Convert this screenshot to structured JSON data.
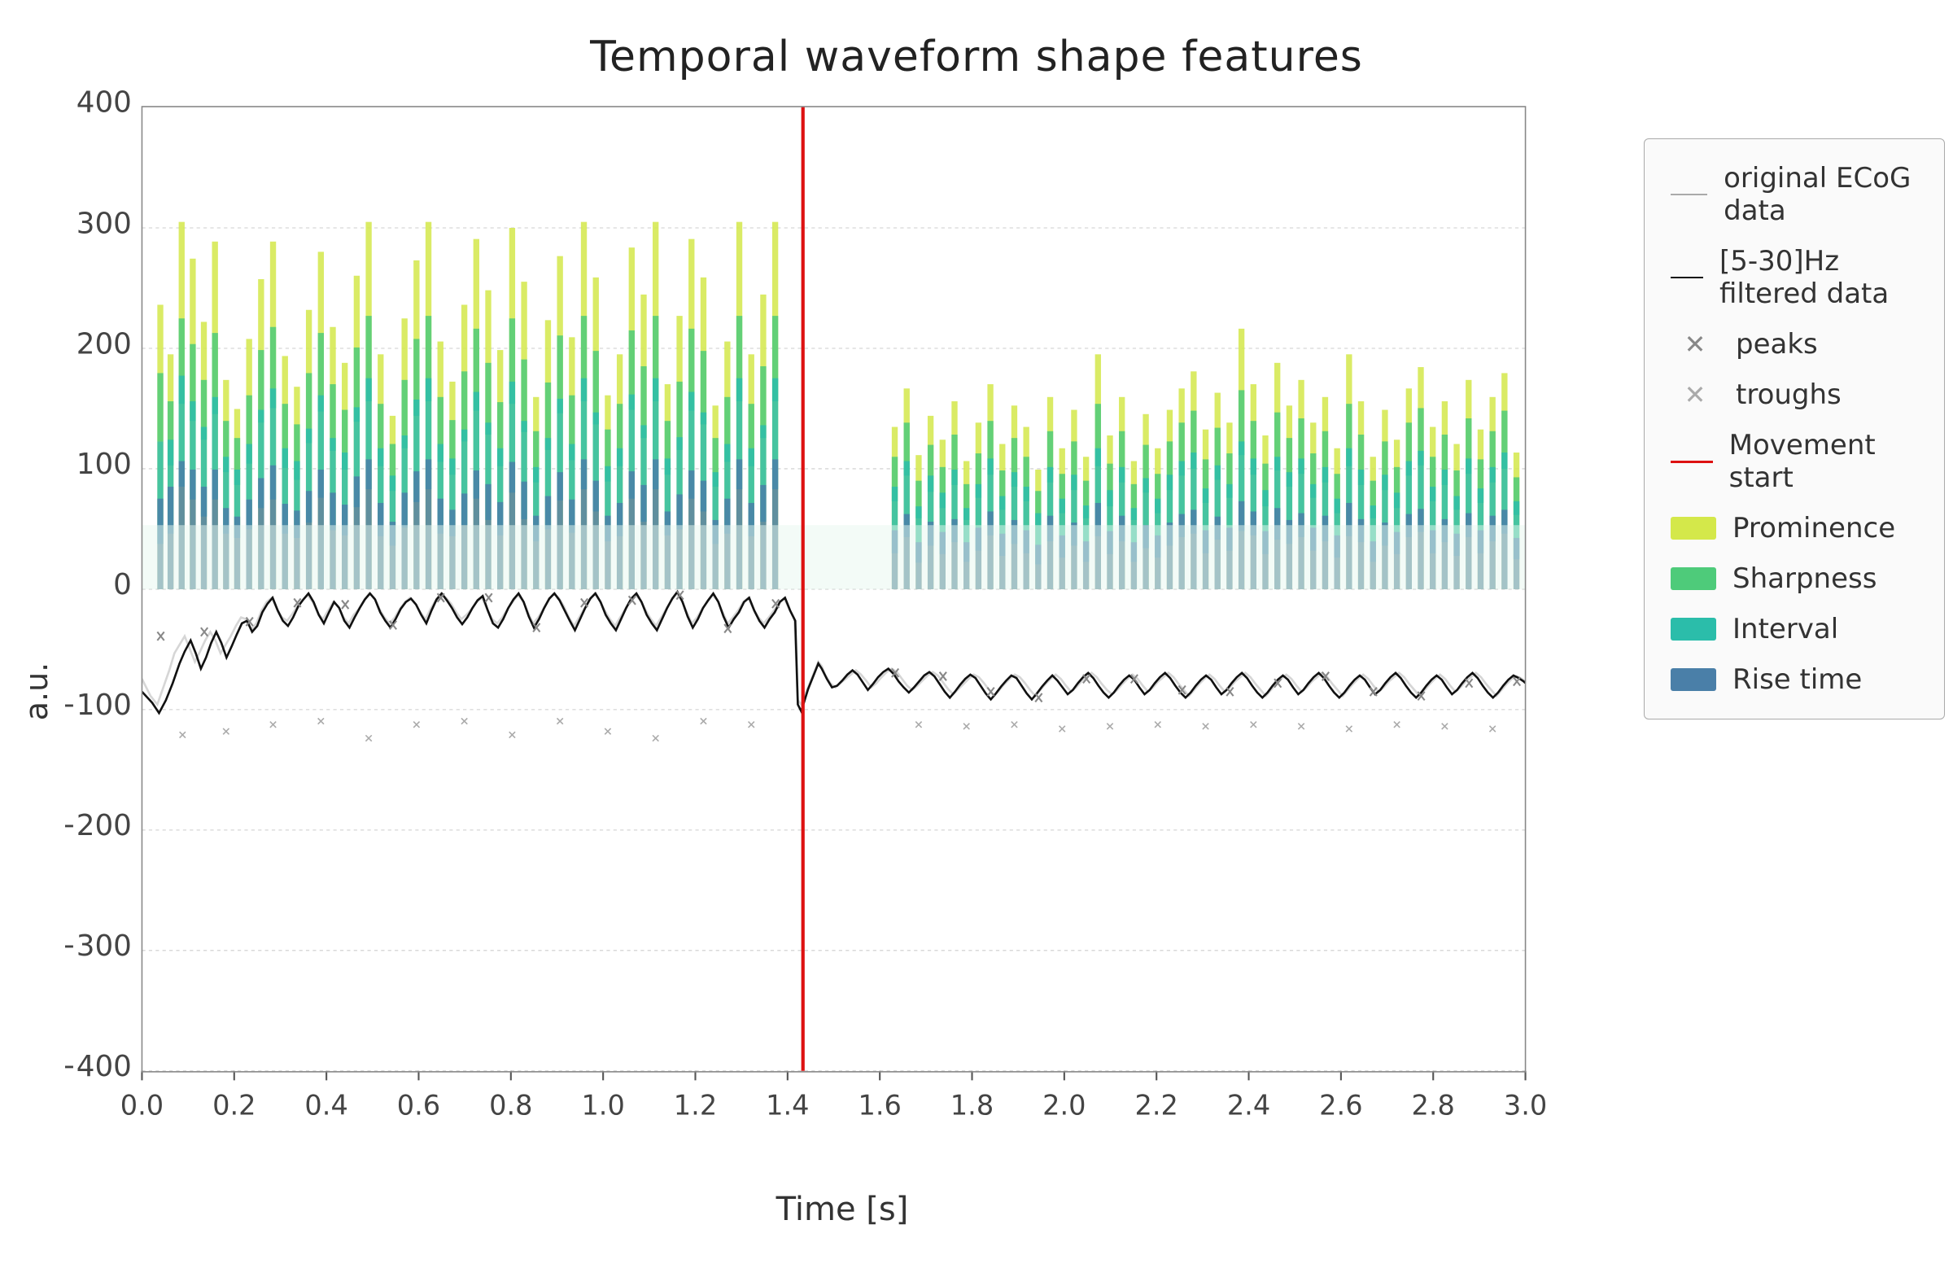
{
  "title": "Temporal waveform shape features",
  "yAxisLabel": "a.u.",
  "xAxisLabel": "Time [s]",
  "legend": {
    "items": [
      {
        "type": "line-gray",
        "label": "original ECoG data"
      },
      {
        "type": "line-black",
        "label": "[5-30]Hz filtered data"
      },
      {
        "type": "marker-gray",
        "label": "peaks"
      },
      {
        "type": "marker-gray2",
        "label": "troughs"
      },
      {
        "type": "line-red",
        "label": "Movement start"
      },
      {
        "type": "color-box",
        "color": "#d4e84a",
        "label": "Prominence"
      },
      {
        "type": "color-box",
        "color": "#4ecb7a",
        "label": "Sharpness"
      },
      {
        "type": "color-box",
        "color": "#2bbdaa",
        "label": "Interval"
      },
      {
        "type": "color-box",
        "color": "#4a7fa8",
        "label": "Rise time"
      }
    ]
  },
  "xAxis": {
    "min": 0,
    "max": 3.0,
    "ticks": [
      "0.0",
      "0.2",
      "0.4",
      "0.6",
      "0.8",
      "1.0",
      "1.2",
      "1.4",
      "1.6",
      "1.8",
      "2.0",
      "2.2",
      "2.4",
      "2.6",
      "2.8",
      "3.0"
    ]
  },
  "yAxis": {
    "ticks": [
      "400",
      "300",
      "200",
      "100",
      "0",
      "-100",
      "-200",
      "-300",
      "-400"
    ]
  },
  "movementStart": 1.47,
  "colors": {
    "prominence": "#d4e84a",
    "sharpness": "#4ecb7a",
    "interval": "#2bbdaa",
    "riseTime": "#4a7fa8",
    "red": "#dd1111",
    "grayLine": "#bbbbbb",
    "blackLine": "#111111"
  }
}
